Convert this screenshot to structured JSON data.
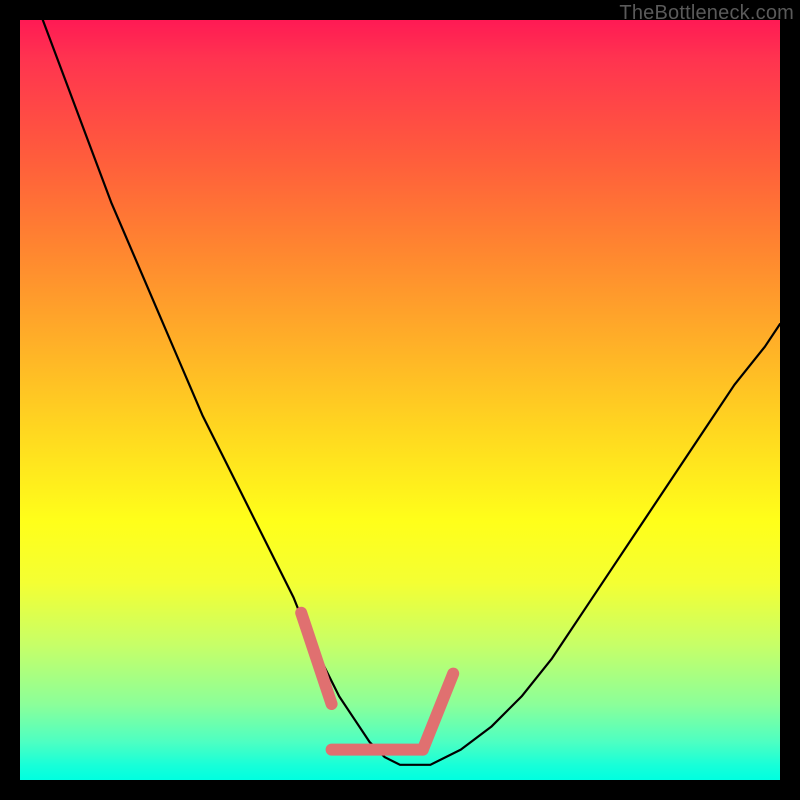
{
  "watermark": "TheBottleneck.com",
  "chart_data": {
    "type": "line",
    "title": "",
    "xlabel": "",
    "ylabel": "",
    "xlim": [
      0,
      100
    ],
    "ylim": [
      0,
      100
    ],
    "series": [
      {
        "name": "bottleneck-curve",
        "x": [
          3,
          6,
          9,
          12,
          15,
          18,
          21,
          24,
          27,
          30,
          33,
          36,
          38,
          40,
          42,
          44,
          46,
          48,
          50,
          54,
          58,
          62,
          66,
          70,
          74,
          78,
          82,
          86,
          90,
          94,
          98,
          100
        ],
        "y": [
          100,
          92,
          84,
          76,
          69,
          62,
          55,
          48,
          42,
          36,
          30,
          24,
          19,
          15,
          11,
          8,
          5,
          3,
          2,
          2,
          4,
          7,
          11,
          16,
          22,
          28,
          34,
          40,
          46,
          52,
          57,
          60
        ]
      }
    ],
    "annotation_segments": [
      {
        "name": "left-slope-marker",
        "x1": 37,
        "y1": 22,
        "x2": 41,
        "y2": 10
      },
      {
        "name": "valley-floor-marker",
        "x1": 41,
        "y1": 4,
        "x2": 53,
        "y2": 4
      },
      {
        "name": "right-slope-marker",
        "x1": 53,
        "y1": 4,
        "x2": 57,
        "y2": 14
      }
    ],
    "colors": {
      "curve": "#000000",
      "marker": "#e07070"
    }
  }
}
